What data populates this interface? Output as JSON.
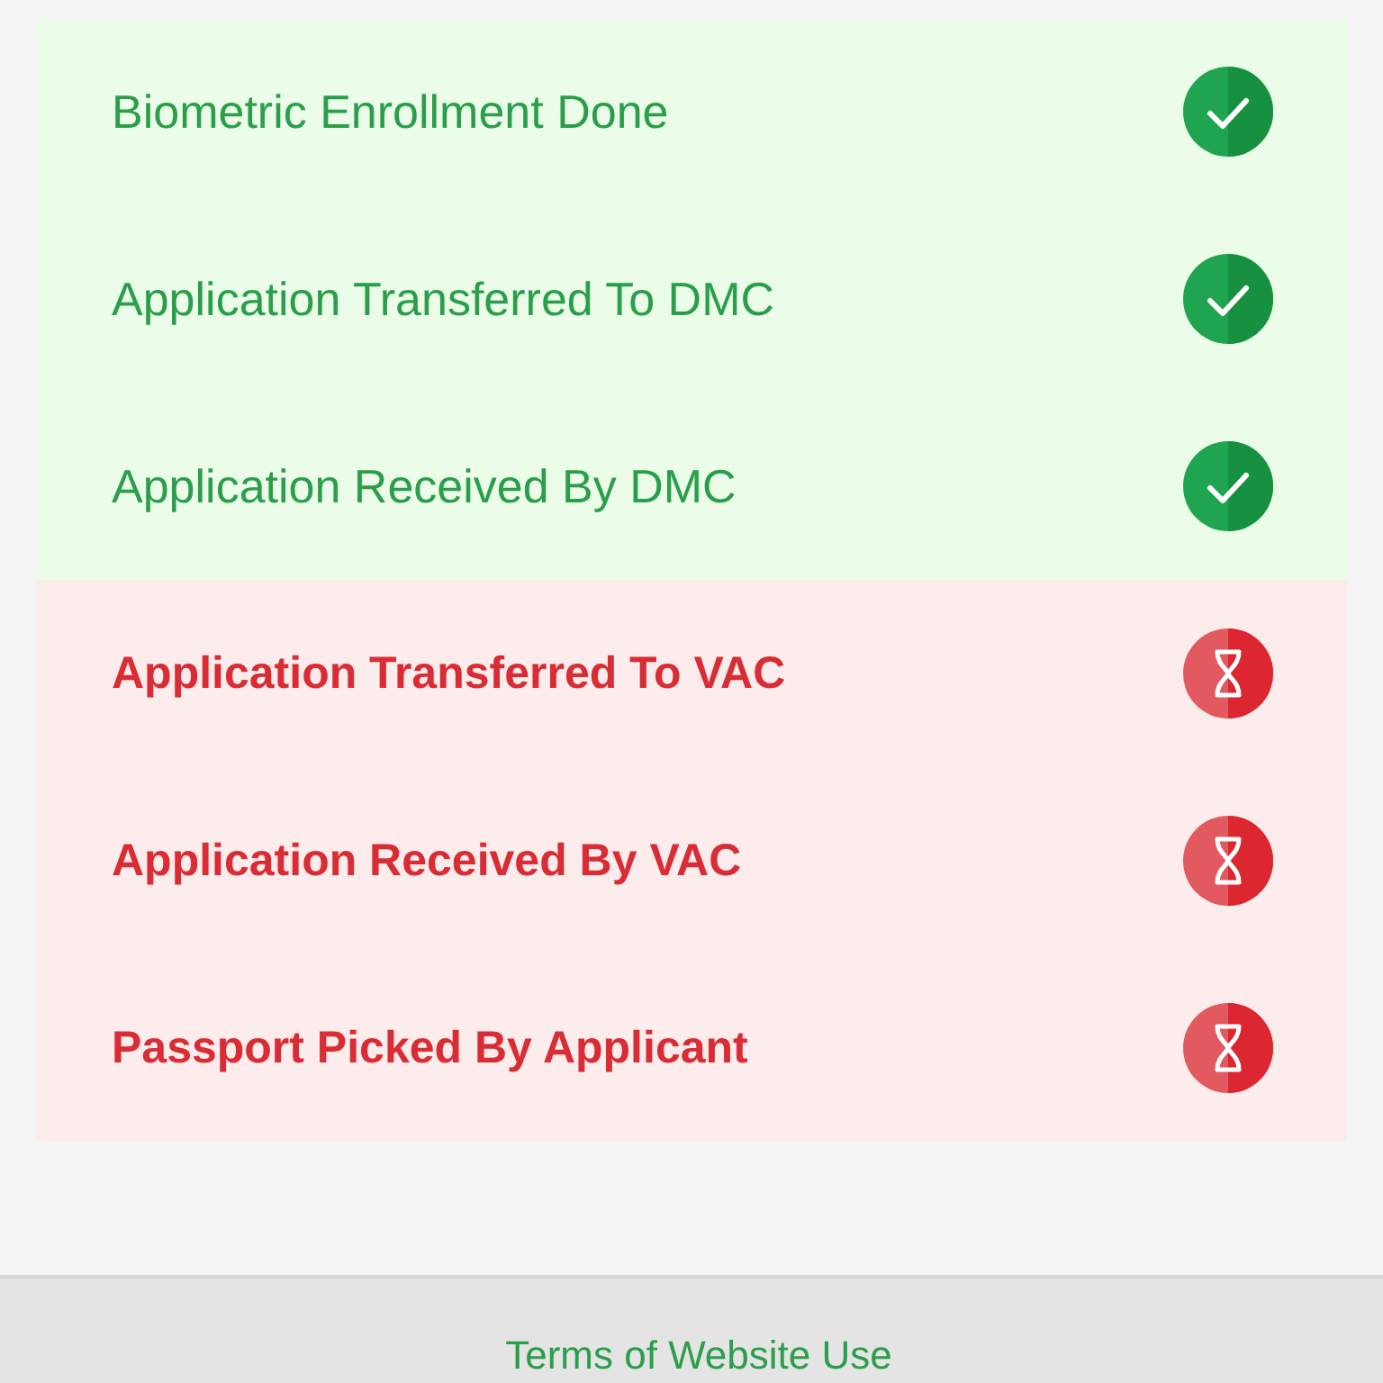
{
  "steps": [
    {
      "label": "Biometric Enrollment Done",
      "completed": true
    },
    {
      "label": "Application Transferred To DMC",
      "completed": true
    },
    {
      "label": "Application Received By DMC",
      "completed": true
    },
    {
      "label": "Application Transferred To VAC",
      "completed": false
    },
    {
      "label": "Application Received By VAC",
      "completed": false
    },
    {
      "label": "Passport Picked By Applicant",
      "completed": false
    }
  ],
  "footer": {
    "link": "Terms of Website Use"
  }
}
